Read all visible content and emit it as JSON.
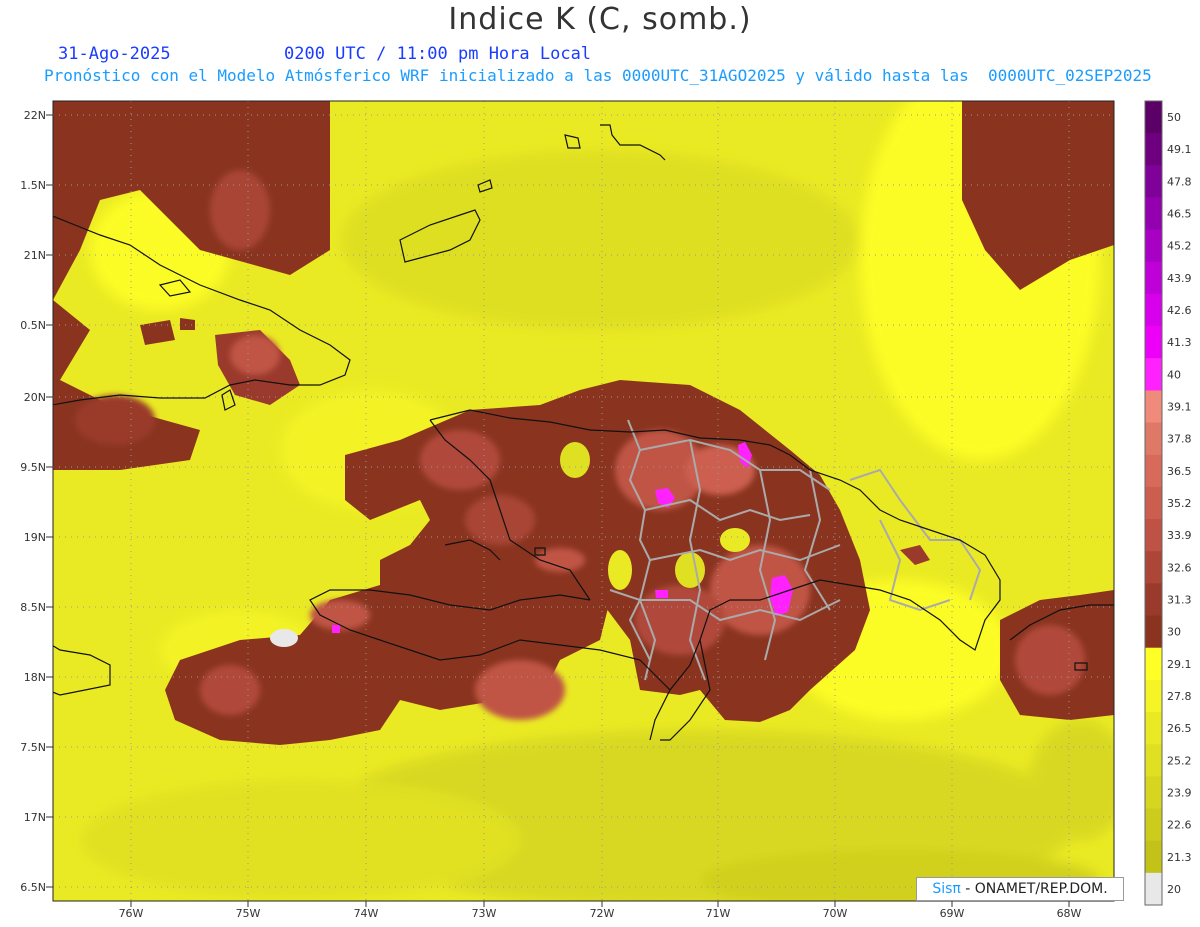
{
  "header": {
    "title": "Indice K (C, somb.)",
    "date": "31-Ago-2025",
    "time": "0200 UTC / 11:00 pm Hora Local",
    "description": "Pronóstico con el Modelo Atmósferico WRF inicializado a las 0000UTC_31AGO2025 y válido hasta las  0000UTC_02SEP2025"
  },
  "axes": {
    "lat_labels": [
      "22N",
      "1.5N",
      "21N",
      "0.5N",
      "20N",
      "9.5N",
      "19N",
      "8.5N",
      "18N",
      "7.5N",
      "17N",
      "6.5N"
    ],
    "lon_labels": [
      "76W",
      "75W",
      "74W",
      "73W",
      "72W",
      "71W",
      "70W",
      "69W",
      "68W"
    ]
  },
  "colorbar": {
    "labels": [
      "50",
      "49.1",
      "47.8",
      "46.5",
      "45.2",
      "43.9",
      "42.6",
      "41.3",
      "40",
      "39.1",
      "37.8",
      "36.5",
      "35.2",
      "33.9",
      "32.6",
      "31.3",
      "30",
      "29.1",
      "27.8",
      "26.5",
      "25.2",
      "23.9",
      "22.6",
      "21.3",
      "20"
    ],
    "colors": [
      "#5a0066",
      "#6e0080",
      "#80009a",
      "#9400b0",
      "#a800c4",
      "#c000d8",
      "#d800ec",
      "#ee00f8",
      "#ff22ff",
      "#f08a7a",
      "#e07868",
      "#d86a5c",
      "#cc5e50",
      "#be5244",
      "#ae4638",
      "#9a3a2c",
      "#8a3420",
      "#ffff26",
      "#f4f426",
      "#eaea24",
      "#e0e022",
      "#d6d620",
      "#cccc1c",
      "#c2c218",
      "#e8e8e8"
    ]
  },
  "credit": {
    "logo": "Sis",
    "pi": "π",
    "text": "- ONAMET/REP.DOM."
  }
}
